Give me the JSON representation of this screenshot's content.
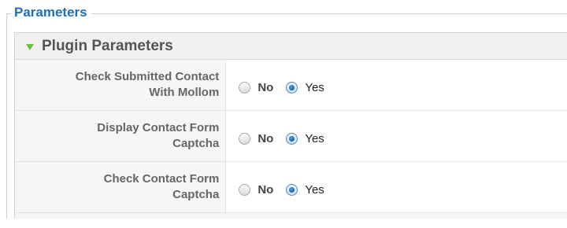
{
  "fieldset": {
    "legend": "Parameters"
  },
  "pane": {
    "title": "Plugin Parameters"
  },
  "params": [
    {
      "label_line1": "Check Submitted Contact",
      "label_line2": "With Mollom",
      "options": [
        "No",
        "Yes"
      ],
      "selected": "Yes"
    },
    {
      "label_line1": "Display Contact Form",
      "label_line2": "Captcha",
      "options": [
        "No",
        "Yes"
      ],
      "selected": "Yes"
    },
    {
      "label_line1": "Check Contact Form",
      "label_line2": "Captcha",
      "options": [
        "No",
        "Yes"
      ],
      "selected": "Yes"
    }
  ],
  "colors": {
    "legend": "#1f6fbf",
    "toggle_icon": "#6fbf3a",
    "pane_title": "#555555"
  }
}
